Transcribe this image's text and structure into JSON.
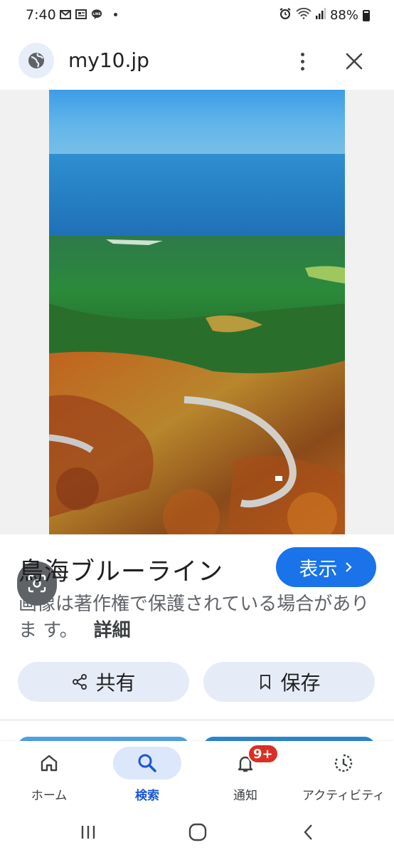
{
  "status_bar": {
    "time": "7:40",
    "battery": "88%",
    "left_icons": [
      "gmail-icon",
      "news-icon",
      "line-icon",
      "dot-icon"
    ],
    "right_icons": [
      "alarm-icon",
      "wifi-icon",
      "signal-icon",
      "battery-icon"
    ]
  },
  "header": {
    "url": "my10.jp"
  },
  "image": {
    "description_icon": "landscape-photo"
  },
  "result": {
    "title": "鳥海ブルーライン",
    "view_button": "表示",
    "copyright_text": "画像は著作権で保護されている場合がありま す。",
    "details_link": "詳細"
  },
  "actions": {
    "share": "共有",
    "save": "保存"
  },
  "colors": {
    "accent": "#1a73e8",
    "badge": "#d93025",
    "action_bg": "#e6ecf7"
  },
  "bottom_nav": {
    "items": [
      {
        "label": "ホーム",
        "icon": "home-icon"
      },
      {
        "label": "検索",
        "icon": "search-icon",
        "active": true
      },
      {
        "label": "通知",
        "icon": "bell-icon",
        "badge": "9+"
      },
      {
        "label": "アクティビティ",
        "icon": "activity-icon"
      }
    ]
  },
  "system_nav": [
    "recents-icon",
    "home-circle-icon",
    "back-icon"
  ]
}
